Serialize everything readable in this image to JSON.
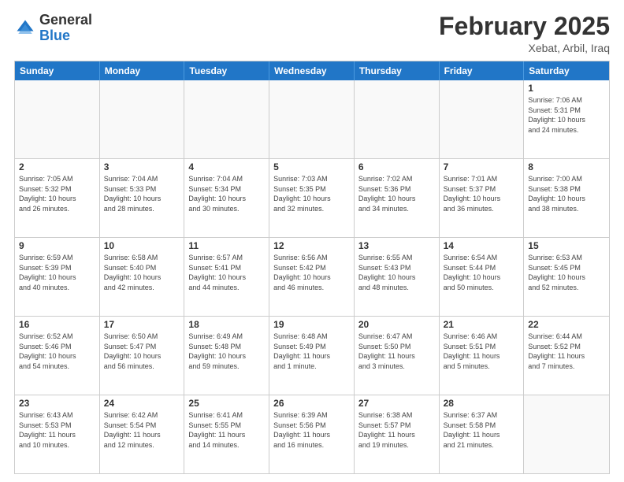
{
  "header": {
    "logo_general": "General",
    "logo_blue": "Blue",
    "month_year": "February 2025",
    "location": "Xebat, Arbil, Iraq"
  },
  "days_of_week": [
    "Sunday",
    "Monday",
    "Tuesday",
    "Wednesday",
    "Thursday",
    "Friday",
    "Saturday"
  ],
  "weeks": [
    [
      {
        "day": "",
        "info": ""
      },
      {
        "day": "",
        "info": ""
      },
      {
        "day": "",
        "info": ""
      },
      {
        "day": "",
        "info": ""
      },
      {
        "day": "",
        "info": ""
      },
      {
        "day": "",
        "info": ""
      },
      {
        "day": "1",
        "info": "Sunrise: 7:06 AM\nSunset: 5:31 PM\nDaylight: 10 hours\nand 24 minutes."
      }
    ],
    [
      {
        "day": "2",
        "info": "Sunrise: 7:05 AM\nSunset: 5:32 PM\nDaylight: 10 hours\nand 26 minutes."
      },
      {
        "day": "3",
        "info": "Sunrise: 7:04 AM\nSunset: 5:33 PM\nDaylight: 10 hours\nand 28 minutes."
      },
      {
        "day": "4",
        "info": "Sunrise: 7:04 AM\nSunset: 5:34 PM\nDaylight: 10 hours\nand 30 minutes."
      },
      {
        "day": "5",
        "info": "Sunrise: 7:03 AM\nSunset: 5:35 PM\nDaylight: 10 hours\nand 32 minutes."
      },
      {
        "day": "6",
        "info": "Sunrise: 7:02 AM\nSunset: 5:36 PM\nDaylight: 10 hours\nand 34 minutes."
      },
      {
        "day": "7",
        "info": "Sunrise: 7:01 AM\nSunset: 5:37 PM\nDaylight: 10 hours\nand 36 minutes."
      },
      {
        "day": "8",
        "info": "Sunrise: 7:00 AM\nSunset: 5:38 PM\nDaylight: 10 hours\nand 38 minutes."
      }
    ],
    [
      {
        "day": "9",
        "info": "Sunrise: 6:59 AM\nSunset: 5:39 PM\nDaylight: 10 hours\nand 40 minutes."
      },
      {
        "day": "10",
        "info": "Sunrise: 6:58 AM\nSunset: 5:40 PM\nDaylight: 10 hours\nand 42 minutes."
      },
      {
        "day": "11",
        "info": "Sunrise: 6:57 AM\nSunset: 5:41 PM\nDaylight: 10 hours\nand 44 minutes."
      },
      {
        "day": "12",
        "info": "Sunrise: 6:56 AM\nSunset: 5:42 PM\nDaylight: 10 hours\nand 46 minutes."
      },
      {
        "day": "13",
        "info": "Sunrise: 6:55 AM\nSunset: 5:43 PM\nDaylight: 10 hours\nand 48 minutes."
      },
      {
        "day": "14",
        "info": "Sunrise: 6:54 AM\nSunset: 5:44 PM\nDaylight: 10 hours\nand 50 minutes."
      },
      {
        "day": "15",
        "info": "Sunrise: 6:53 AM\nSunset: 5:45 PM\nDaylight: 10 hours\nand 52 minutes."
      }
    ],
    [
      {
        "day": "16",
        "info": "Sunrise: 6:52 AM\nSunset: 5:46 PM\nDaylight: 10 hours\nand 54 minutes."
      },
      {
        "day": "17",
        "info": "Sunrise: 6:50 AM\nSunset: 5:47 PM\nDaylight: 10 hours\nand 56 minutes."
      },
      {
        "day": "18",
        "info": "Sunrise: 6:49 AM\nSunset: 5:48 PM\nDaylight: 10 hours\nand 59 minutes."
      },
      {
        "day": "19",
        "info": "Sunrise: 6:48 AM\nSunset: 5:49 PM\nDaylight: 11 hours\nand 1 minute."
      },
      {
        "day": "20",
        "info": "Sunrise: 6:47 AM\nSunset: 5:50 PM\nDaylight: 11 hours\nand 3 minutes."
      },
      {
        "day": "21",
        "info": "Sunrise: 6:46 AM\nSunset: 5:51 PM\nDaylight: 11 hours\nand 5 minutes."
      },
      {
        "day": "22",
        "info": "Sunrise: 6:44 AM\nSunset: 5:52 PM\nDaylight: 11 hours\nand 7 minutes."
      }
    ],
    [
      {
        "day": "23",
        "info": "Sunrise: 6:43 AM\nSunset: 5:53 PM\nDaylight: 11 hours\nand 10 minutes."
      },
      {
        "day": "24",
        "info": "Sunrise: 6:42 AM\nSunset: 5:54 PM\nDaylight: 11 hours\nand 12 minutes."
      },
      {
        "day": "25",
        "info": "Sunrise: 6:41 AM\nSunset: 5:55 PM\nDaylight: 11 hours\nand 14 minutes."
      },
      {
        "day": "26",
        "info": "Sunrise: 6:39 AM\nSunset: 5:56 PM\nDaylight: 11 hours\nand 16 minutes."
      },
      {
        "day": "27",
        "info": "Sunrise: 6:38 AM\nSunset: 5:57 PM\nDaylight: 11 hours\nand 19 minutes."
      },
      {
        "day": "28",
        "info": "Sunrise: 6:37 AM\nSunset: 5:58 PM\nDaylight: 11 hours\nand 21 minutes."
      },
      {
        "day": "",
        "info": ""
      }
    ]
  ]
}
